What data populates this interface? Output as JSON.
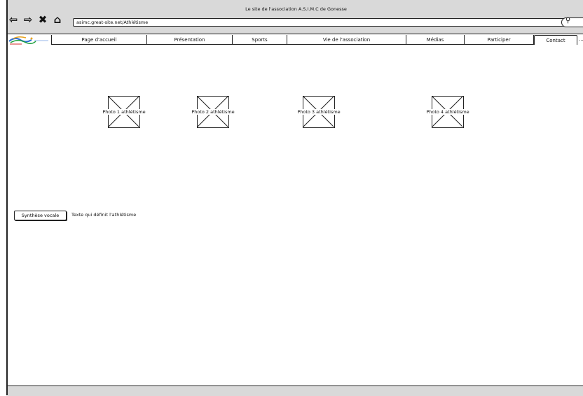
{
  "window": {
    "title": "Le site de l'association A.S.I.M.C de Gonesse"
  },
  "browser": {
    "url": "asimc.great-site.net/Athlétisme",
    "icons": [
      "back-icon",
      "forward-icon",
      "close-icon",
      "home-icon",
      "search-icon"
    ]
  },
  "nav": {
    "items": [
      {
        "label": "Page d'accueil"
      },
      {
        "label": "Présentation"
      },
      {
        "label": "Sports"
      },
      {
        "label": "Vie de l'association"
      },
      {
        "label": "Médias"
      },
      {
        "label": "Participer"
      },
      {
        "label": "Contact",
        "selected": true
      }
    ],
    "more": "..."
  },
  "photos": [
    {
      "label": "Photo 1 athlétisme"
    },
    {
      "label": "Photo 2 athlétisme"
    },
    {
      "label": "Photo 3 athlétisme"
    },
    {
      "label": "Photo 4 athlétisme"
    }
  ],
  "tts": {
    "button_label": "Synthèse vocale"
  },
  "content": {
    "description": "Texte qui définit l'athlétisme"
  }
}
